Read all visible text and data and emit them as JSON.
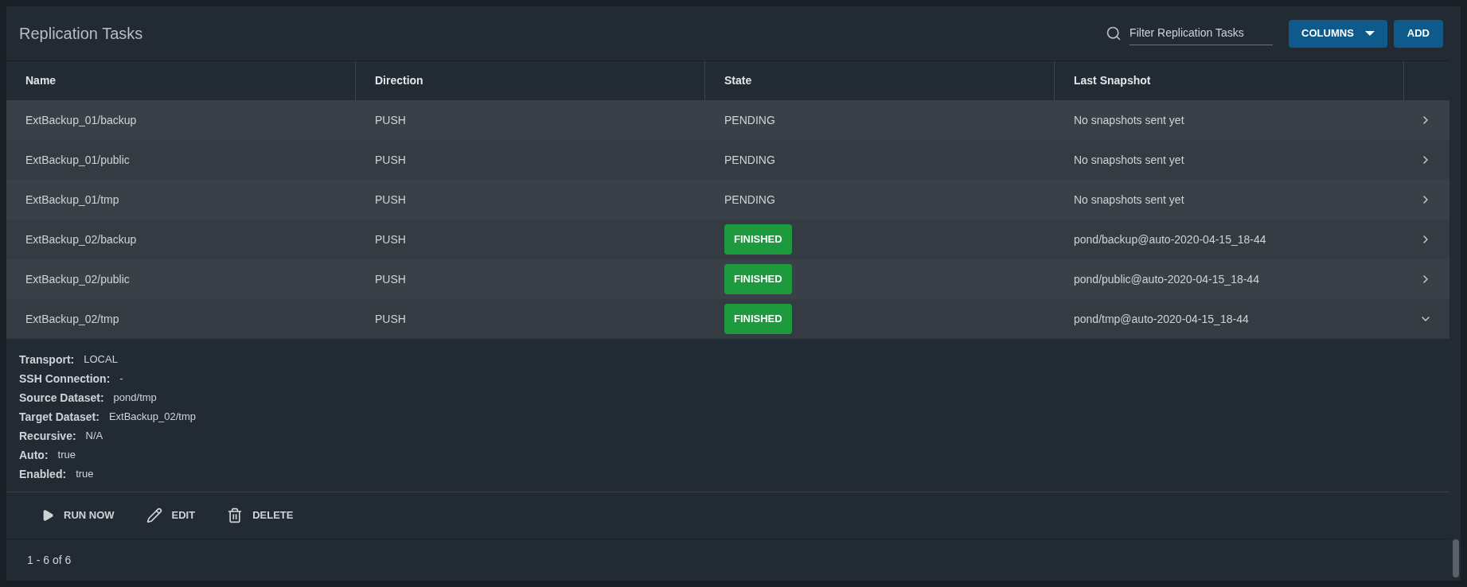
{
  "title": "Replication Tasks",
  "filter": {
    "placeholder": "Filter Replication Tasks"
  },
  "buttons": {
    "columns": "COLUMNS",
    "add": "ADD"
  },
  "columns": [
    "Name",
    "Direction",
    "State",
    "Last Snapshot"
  ],
  "rows": [
    {
      "name": "ExtBackup_01/backup",
      "direction": "PUSH",
      "state": {
        "kind": "plain",
        "text": "PENDING"
      },
      "last_snapshot": "No snapshots sent yet",
      "expanded": false
    },
    {
      "name": "ExtBackup_01/public",
      "direction": "PUSH",
      "state": {
        "kind": "plain",
        "text": "PENDING"
      },
      "last_snapshot": "No snapshots sent yet",
      "expanded": false
    },
    {
      "name": "ExtBackup_01/tmp",
      "direction": "PUSH",
      "state": {
        "kind": "plain",
        "text": "PENDING"
      },
      "last_snapshot": "No snapshots sent yet",
      "expanded": false
    },
    {
      "name": "ExtBackup_02/backup",
      "direction": "PUSH",
      "state": {
        "kind": "badge",
        "text": "FINISHED"
      },
      "last_snapshot": "pond/backup@auto-2020-04-15_18-44",
      "expanded": false
    },
    {
      "name": "ExtBackup_02/public",
      "direction": "PUSH",
      "state": {
        "kind": "badge",
        "text": "FINISHED"
      },
      "last_snapshot": "pond/public@auto-2020-04-15_18-44",
      "expanded": false
    },
    {
      "name": "ExtBackup_02/tmp",
      "direction": "PUSH",
      "state": {
        "kind": "badge",
        "text": "FINISHED"
      },
      "last_snapshot": "pond/tmp@auto-2020-04-15_18-44",
      "expanded": true
    }
  ],
  "details": [
    {
      "label": "Transport:",
      "value": "LOCAL"
    },
    {
      "label": "SSH Connection:",
      "value": "-"
    },
    {
      "label": "Source Dataset:",
      "value": "pond/tmp"
    },
    {
      "label": "Target Dataset:",
      "value": "ExtBackup_02/tmp"
    },
    {
      "label": "Recursive:",
      "value": "N/A"
    },
    {
      "label": "Auto:",
      "value": "true"
    },
    {
      "label": "Enabled:",
      "value": "true"
    }
  ],
  "actions": [
    {
      "kind": "run",
      "label": "RUN NOW"
    },
    {
      "kind": "edit",
      "label": "EDIT"
    },
    {
      "kind": "delete",
      "label": "DELETE"
    }
  ],
  "pagination": "1 - 6 of 6"
}
